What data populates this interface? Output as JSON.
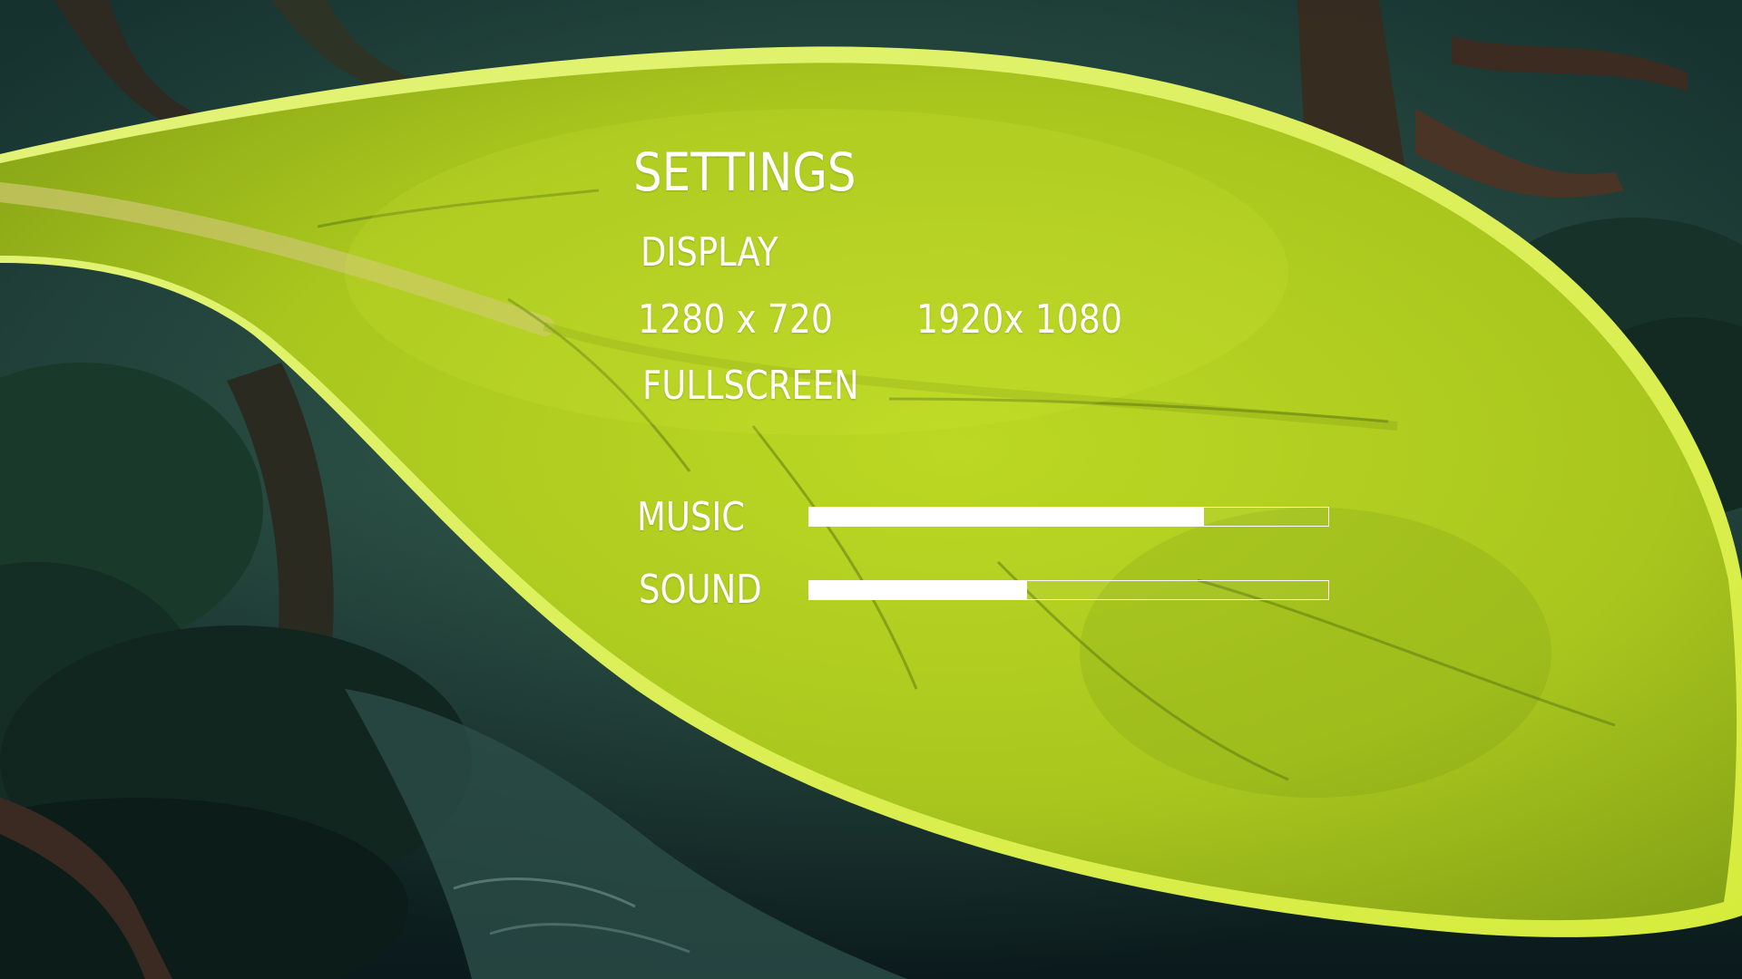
{
  "settings": {
    "title": "SETTINGS",
    "display": {
      "heading": "DISPLAY",
      "resolutions": [
        "1280 x 720",
        "1920x 1080"
      ],
      "fullscreen_label": "FULLSCREEN"
    },
    "audio": {
      "music": {
        "label": "MUSIC",
        "level": 0.76
      },
      "sound": {
        "label": "SOUND",
        "level": 0.42
      }
    }
  },
  "colors": {
    "text": "#ffffff",
    "leaf_light": "#c9e02a",
    "leaf_mid": "#a7c51c",
    "leaf_dark": "#6f8f12",
    "forest_dark": "#0c1f1c",
    "forest_mid": "#1d3b33"
  }
}
